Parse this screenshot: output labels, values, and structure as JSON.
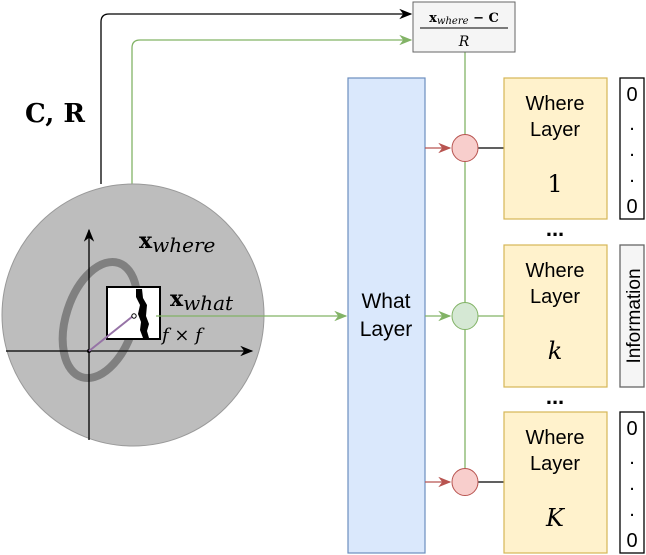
{
  "formula": {
    "numerator_x": "x",
    "numerator_sub": "where",
    "numerator_rest": " − C",
    "denominator": "R"
  },
  "labels": {
    "center_radius": "C, R",
    "x_where": "x",
    "x_where_sub": "where",
    "x_what": "x",
    "x_what_sub": "what",
    "patch_size": "f × f"
  },
  "what_layer": {
    "line1": "What",
    "line2": "Layer"
  },
  "where_layers": [
    {
      "line1": "Where",
      "line2": "Layer",
      "index": "1",
      "gate_color": "#f8cecc"
    },
    {
      "line1": "Where",
      "line2": "Layer",
      "index": "k",
      "gate_color": "#d5e8d4"
    },
    {
      "line1": "Where",
      "line2": "Layer",
      "index": "K",
      "gate_color": "#f8cecc"
    }
  ],
  "ellipsis": "...",
  "outputs": {
    "first": [
      "0",
      ".",
      ".",
      ".",
      "0"
    ],
    "middle": "Information",
    "last": [
      "0",
      ".",
      ".",
      ".",
      "0"
    ]
  },
  "colors": {
    "green": "#82b366",
    "red": "#b85450",
    "blue_fill": "#dae8fc",
    "blue_stroke": "#6c8ebf",
    "yellow_fill": "#fff2cc",
    "yellow_stroke": "#d6b656",
    "disc": "#bdbdbd"
  }
}
